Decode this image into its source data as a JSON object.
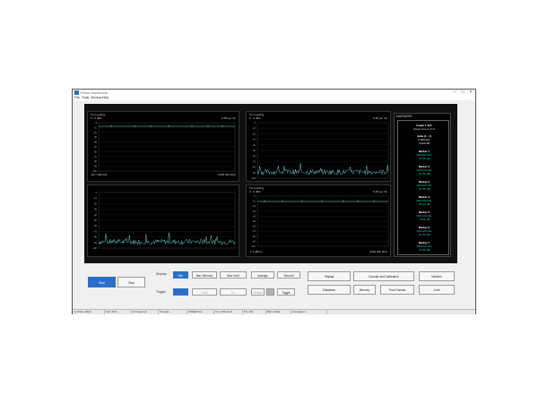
{
  "window": {
    "title": "Prism Mainframe"
  },
  "menu": [
    "File",
    "Tools",
    "Window",
    "Help"
  ],
  "panels": [
    {
      "header": "5.0 Log/Rng",
      "line2": "0 - 0 dBm",
      "right": "5 dB per div",
      "footer_left": "-50.7 dBm/Hz",
      "footer_right": "5000.000 MHz"
    },
    {
      "header": "5.0 Log/Rng",
      "line2": "0 - 0 dBm",
      "right": "5 dB per div",
      "footer_left": "",
      "footer_right": ""
    },
    {
      "header": "5.0 Log/Rng",
      "line2": "0 - 0 dBm",
      "right": "5 dB per div",
      "footer_left": "",
      "footer_right": ""
    },
    {
      "header": "5.0 Log/Rng",
      "line2": "0 - 0 dBm",
      "right": "5 dB per div",
      "footer_left": "-7.3 dBm/s",
      "footer_right": "5000.000 MHz"
    }
  ],
  "markers_panel": {
    "title": "MARKERS",
    "graph": "Graph 1 S21",
    "graph_sub": "Swept sine 0-3 Hz",
    "entries": [
      {
        "name": "delta (1 - 1)",
        "freq": "0.000 kHz",
        "level": "0.000 dB",
        "color": "#e8e8e8"
      },
      {
        "name": "Marker 1",
        "freq": "990.000 kHz",
        "level": "-97.56 dB",
        "color": "#19c6b4"
      },
      {
        "name": "Marker 2",
        "freq": "990.000 kHz",
        "level": "-97.56 dB",
        "color": "#19c6b4"
      },
      {
        "name": "Marker 3",
        "freq": "990.000 kHz",
        "level": "-97.56 dB",
        "color": "#19c6b4"
      },
      {
        "name": "Marker 4",
        "freq": "990.000 kHz",
        "level": "-95.33 dB",
        "color": "#19c6b4"
      },
      {
        "name": "Marker 5",
        "freq": "990.000 kHz",
        "level": "-75.56 dB",
        "color": "#19c6b4"
      },
      {
        "name": "Marker 6",
        "freq": "990.000 kHz",
        "level": "-97.56 dB",
        "color": "#19c6b4"
      },
      {
        "name": "Marker 7",
        "freq": "990.000 kHz",
        "level": "-97.56 dB",
        "color": "#19c6b4"
      }
    ]
  },
  "controls": {
    "start": "Start",
    "stop": "Stop",
    "display_label": "Display",
    "display_buttons": [
      "Min",
      "Max Memory",
      "Max Hold",
      "Average",
      "Smooth"
    ],
    "trigger_label": "Trigger",
    "trigger_buttons": [
      "",
      "Limit",
      "Ext",
      "Manual",
      "",
      "Toggle"
    ],
    "right_buttons": [
      "Display",
      "Domain and Calibration",
      "Markers",
      "Database",
      "Memory",
      "Time Domain",
      "Limit"
    ]
  },
  "status": [
    "(c) Prism 2022",
    "CH1  S21 ...",
    "10 Freq Cal",
    "IF band...",
    "SWEEP  Ru",
    "FC  2.250 GHz",
    "Pts 201",
    "BW 1 MHz",
    "Averages 1"
  ],
  "colors": {
    "trace": "#6fe3d4",
    "accent": "#2b6fc8"
  }
}
